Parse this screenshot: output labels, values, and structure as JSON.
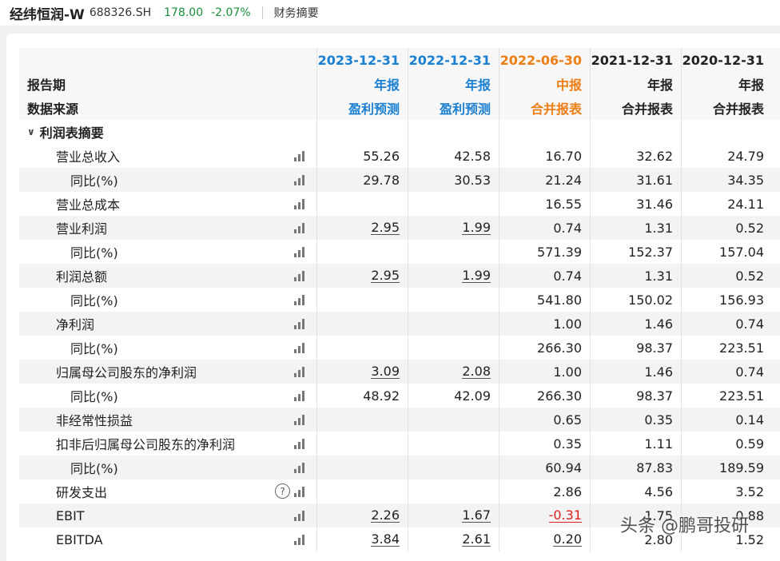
{
  "header": {
    "stock_name": "经纬恒润-W",
    "stock_code": "688326.SH",
    "price": "178.00",
    "change": "-2.07%",
    "nav_tab": "财务摘要"
  },
  "table": {
    "periods": [
      {
        "date": "2023-12-31",
        "type": "年报",
        "source": "盈利预测",
        "color": "#1a7fd0"
      },
      {
        "date": "2022-12-31",
        "type": "年报",
        "source": "盈利预测",
        "color": "#1a7fd0"
      },
      {
        "date": "2022-06-30",
        "type": "中报",
        "source": "合并报表",
        "color": "#ee7d13"
      },
      {
        "date": "2021-12-31",
        "type": "年报",
        "source": "合并报表",
        "color": "#222222"
      },
      {
        "date": "2020-12-31",
        "type": "年报",
        "source": "合并报表",
        "color": "#222222"
      }
    ],
    "label_period": "报告期",
    "label_source": "数据来源",
    "section_title": "利润表摘要",
    "rows": [
      {
        "label": "营业总收入",
        "sub": false,
        "values": [
          "55.26",
          "42.58",
          "16.70",
          "32.62",
          "24.79"
        ]
      },
      {
        "label": "同比(%)",
        "sub": true,
        "values": [
          "29.78",
          "30.53",
          "21.24",
          "31.61",
          "34.35"
        ]
      },
      {
        "label": "营业总成本",
        "sub": false,
        "values": [
          "",
          "",
          "16.55",
          "31.46",
          "24.11"
        ]
      },
      {
        "label": "营业利润",
        "sub": false,
        "values": [
          "2.95",
          "1.99",
          "0.74",
          "1.31",
          "0.52"
        ],
        "link_cols": [
          0,
          1
        ]
      },
      {
        "label": "同比(%)",
        "sub": true,
        "values": [
          "",
          "",
          "571.39",
          "152.37",
          "157.04"
        ]
      },
      {
        "label": "利润总额",
        "sub": false,
        "values": [
          "2.95",
          "1.99",
          "0.74",
          "1.31",
          "0.52"
        ],
        "link_cols": [
          0,
          1
        ]
      },
      {
        "label": "同比(%)",
        "sub": true,
        "values": [
          "",
          "",
          "541.80",
          "150.02",
          "156.93"
        ]
      },
      {
        "label": "净利润",
        "sub": false,
        "values": [
          "",
          "",
          "1.00",
          "1.46",
          "0.74"
        ]
      },
      {
        "label": "同比(%)",
        "sub": true,
        "values": [
          "",
          "",
          "266.30",
          "98.37",
          "223.51"
        ]
      },
      {
        "label": "归属母公司股东的净利润",
        "sub": false,
        "values": [
          "3.09",
          "2.08",
          "1.00",
          "1.46",
          "0.74"
        ],
        "link_cols": [
          0,
          1
        ]
      },
      {
        "label": "同比(%)",
        "sub": true,
        "values": [
          "48.92",
          "42.09",
          "266.30",
          "98.37",
          "223.51"
        ]
      },
      {
        "label": "非经常性损益",
        "sub": false,
        "values": [
          "",
          "",
          "0.65",
          "0.35",
          "0.14"
        ]
      },
      {
        "label": "扣非后归属母公司股东的净利润",
        "sub": false,
        "values": [
          "",
          "",
          "0.35",
          "1.11",
          "0.59"
        ]
      },
      {
        "label": "同比(%)",
        "sub": true,
        "values": [
          "",
          "",
          "60.94",
          "87.83",
          "189.59"
        ]
      },
      {
        "label": "研发支出",
        "sub": false,
        "values": [
          "",
          "",
          "2.86",
          "4.56",
          "3.52"
        ],
        "help": true
      },
      {
        "label": "EBIT",
        "sub": false,
        "values": [
          "2.26",
          "1.67",
          "-0.31",
          "1.75",
          "0.88"
        ],
        "link_cols": [
          0,
          1,
          2
        ],
        "neg_cols": [
          2
        ]
      },
      {
        "label": "EBITDA",
        "sub": false,
        "values": [
          "3.84",
          "2.61",
          "0.20",
          "2.80",
          "1.52"
        ],
        "link_cols": [
          0,
          1,
          2
        ]
      }
    ]
  },
  "watermark": "头条 @鹏哥投研",
  "colors": {
    "up": "#e02020",
    "down": "#1a8f3c",
    "forecast": "#1a7fd0",
    "interim": "#ee7d13"
  }
}
